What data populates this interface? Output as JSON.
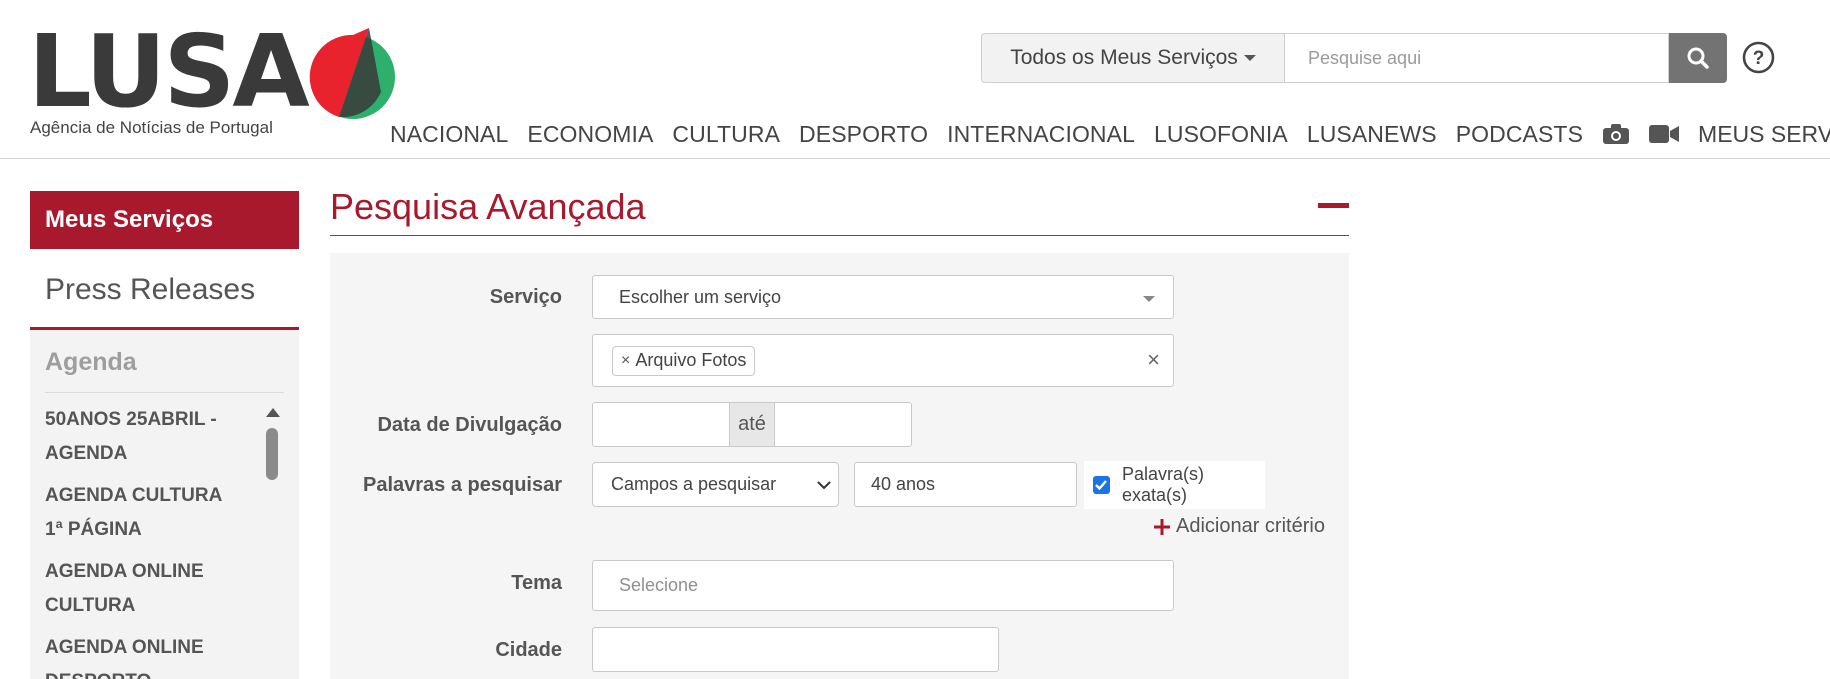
{
  "header": {
    "logo_text": "LUSA",
    "logo_tagline": "Agência de Notícias de Portugal",
    "services_dropdown": "Todos os Meus Serviços",
    "search_placeholder": "Pesquise aqui"
  },
  "nav": {
    "items": [
      "NACIONAL",
      "ECONOMIA",
      "CULTURA",
      "DESPORTO",
      "INTERNACIONAL",
      "LUSOFONIA",
      "LUSANEWS",
      "PODCASTS"
    ],
    "icons": [
      "camera-icon",
      "video-icon"
    ],
    "my_services": "MEUS SERVIÇOS"
  },
  "sidebar": {
    "title": "Meus Serviços",
    "press_releases": "Press Releases",
    "agenda": "Agenda",
    "items": [
      {
        "line1": "50ANOS 25ABRIL -",
        "line2": "AGENDA"
      },
      {
        "line1": "AGENDA CULTURA",
        "line2": "1ª PÁGINA"
      },
      {
        "line1": "AGENDA ONLINE",
        "line2": "CULTURA"
      },
      {
        "line1": "AGENDA ONLINE",
        "line2": "DESPORTO"
      }
    ]
  },
  "search": {
    "title": "Pesquisa Avançada",
    "service_label": "Serviço",
    "service_select": "Escolher um serviço",
    "service_tag": "Arquivo Fotos",
    "date_label": "Data de Divulgação",
    "date_from": "",
    "date_sep": "até",
    "date_to": "",
    "words_label": "Palavras a pesquisar",
    "fields_select": "Campos a pesquisar",
    "words_value": "40 anos",
    "exact_label": "Palavra(s) exata(s)",
    "exact_checked": true,
    "add_criteria": "Adicionar critério",
    "theme_label": "Tema",
    "theme_placeholder": "Selecione",
    "city_label": "Cidade",
    "city_value": ""
  },
  "colors": {
    "brand_red": "#a8192e",
    "logo_green": "#2db06b",
    "logo_red": "#e8232e",
    "checkbox_blue": "#1a73e8"
  }
}
